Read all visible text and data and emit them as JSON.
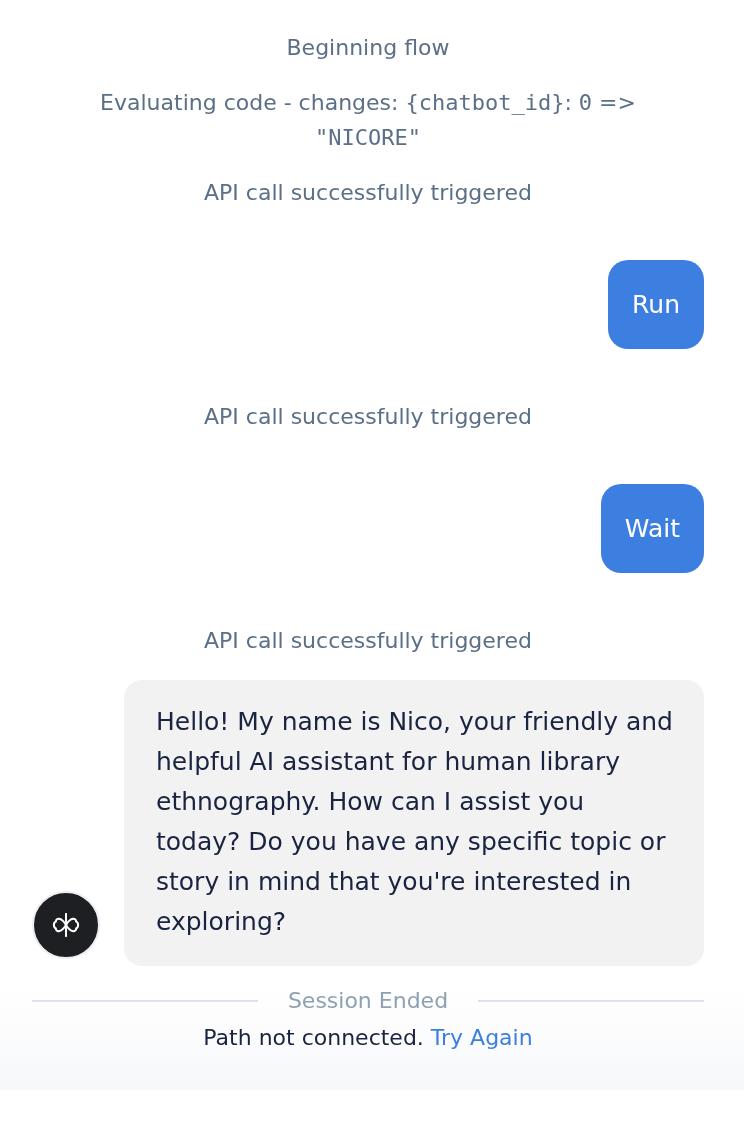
{
  "messages": [
    {
      "kind": "system",
      "parts": [
        {
          "kind": "text",
          "text": "Beginning flow"
        }
      ]
    },
    {
      "kind": "system",
      "parts": [
        {
          "kind": "text",
          "text": "Evaluating code - changes: "
        },
        {
          "kind": "code",
          "text": "{chatbot_id}"
        },
        {
          "kind": "text",
          "text": ": "
        },
        {
          "kind": "code",
          "text": "0"
        },
        {
          "kind": "text",
          "text": " => "
        },
        {
          "kind": "code",
          "text": "\"NICORE\""
        }
      ]
    },
    {
      "kind": "system",
      "parts": [
        {
          "kind": "text",
          "text": "API call successfully triggered"
        }
      ]
    },
    {
      "kind": "user",
      "text": "Run"
    },
    {
      "kind": "system",
      "parts": [
        {
          "kind": "text",
          "text": "API call successfully triggered"
        }
      ]
    },
    {
      "kind": "user",
      "text": "Wait"
    },
    {
      "kind": "system",
      "parts": [
        {
          "kind": "text",
          "text": "API call successfully triggered"
        }
      ]
    },
    {
      "kind": "bot",
      "text": "Hello! My name is Nico, your friendly and helpful AI assistant for human library ethnography. How can I assist you today? Do you have any specific topic or story in mind that you're interested in exploring?"
    }
  ],
  "session": {
    "divider_label": "Session Ended",
    "status": "Path not connected.",
    "link": "Try Again"
  }
}
